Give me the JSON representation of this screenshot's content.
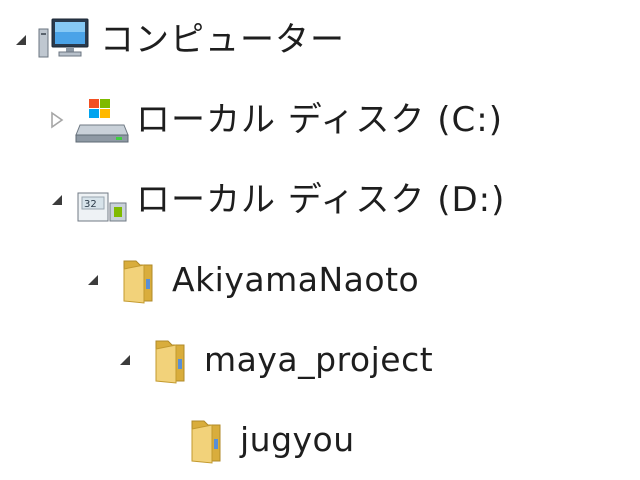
{
  "tree": {
    "nodes": [
      {
        "label": "コンピューター",
        "icon": "computer-icon",
        "expander": "expanded"
      },
      {
        "label": "ローカル ディスク (C:)",
        "icon": "system-drive-icon",
        "expander": "collapsed"
      },
      {
        "label": "ローカル ディスク (D:)",
        "icon": "local-drive-icon",
        "expander": "expanded"
      },
      {
        "label": "AkiyamaNaoto",
        "icon": "folder-icon",
        "expander": "expanded"
      },
      {
        "label": "maya_project",
        "icon": "folder-icon",
        "expander": "expanded"
      },
      {
        "label": "jugyou",
        "icon": "folder-icon",
        "expander": "none"
      }
    ]
  },
  "colors": {
    "text": "#1e1e1e",
    "expanded_arrow": "#3c3c3c",
    "collapsed_arrow": "#a6a6a6",
    "folder": "#e9c65f"
  }
}
